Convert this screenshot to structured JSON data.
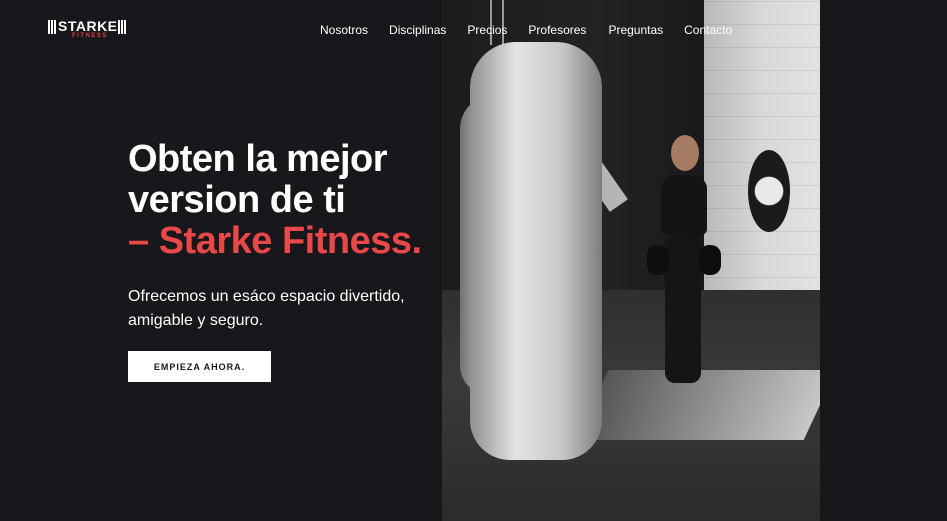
{
  "brand": {
    "name": "STARKE",
    "tagline": "FITNESS",
    "logo_icon": "barbell-icon",
    "accent_color": "#e94848"
  },
  "nav": {
    "items": [
      {
        "label": "Nosotros"
      },
      {
        "label": "Disciplinas"
      },
      {
        "label": "Precios"
      },
      {
        "label": "Profesores"
      },
      {
        "label": "Preguntas"
      },
      {
        "label": "Contacto"
      }
    ]
  },
  "hero": {
    "title_line1": "Obten la mejor",
    "title_line2": "version de ti",
    "title_accent": "– Starke Fitness.",
    "description": "Ofrecemos un esáco espacio divertido, amigable y seguro.",
    "cta_label": "EMPIEZA AHORA.",
    "image": "boxing-gym-photo"
  },
  "colors": {
    "background": "#18171b",
    "text": "#ffffff",
    "accent": "#e94848",
    "button_bg": "#ffffff",
    "button_text": "#1a1a1a"
  }
}
